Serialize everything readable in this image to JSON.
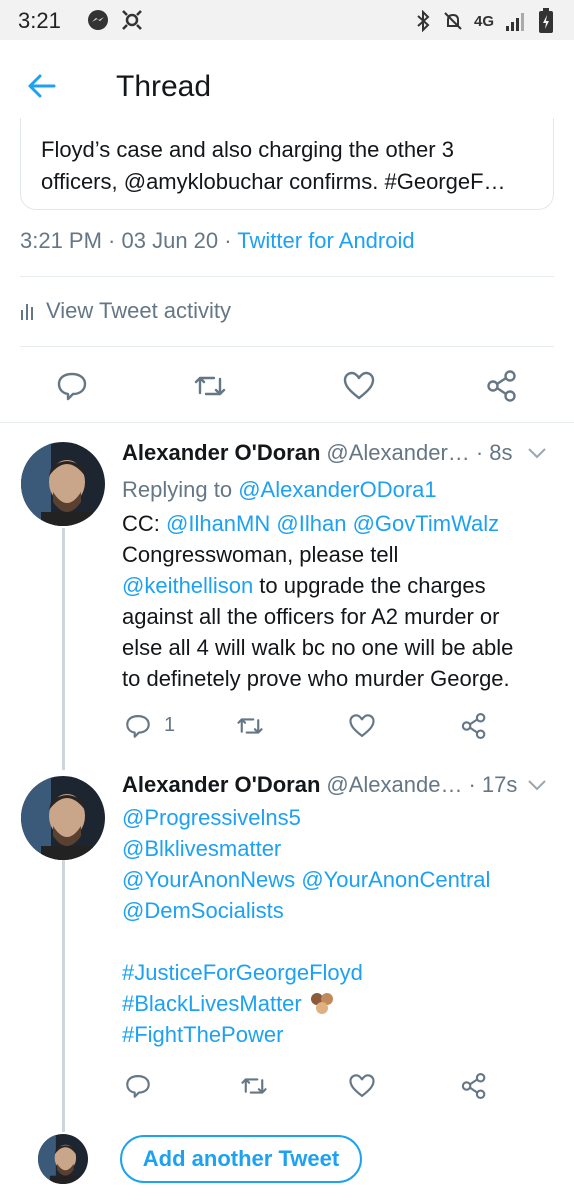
{
  "status_bar": {
    "time": "3:21",
    "network": "4G"
  },
  "header": {
    "title": "Thread"
  },
  "quoted_tweet": {
    "line1": "Floyd’s case and also charging the other 3",
    "line2": "officers, @amyklobuchar confirms. #GeorgeF…"
  },
  "tweet_meta": {
    "time": "3:21 PM",
    "sep1": " · ",
    "date": "03 Jun 20",
    "sep2": " · ",
    "source": "Twitter for Android"
  },
  "activity": {
    "label": "View Tweet activity"
  },
  "replies": [
    {
      "name": "Alexander O'Doran",
      "handle": "@Alexander…",
      "time": "· 8s",
      "replying_prefix": "Replying to ",
      "replying_to": "@AlexanderODora1",
      "cc_prefix": "CC: ",
      "mentions": [
        "@IlhanMN",
        "@Ilhan",
        "@GovTimWalz"
      ],
      "line3": "Congresswoman, please tell",
      "mention4": "@keithellison",
      "line4_rest": " to upgrade the charges",
      "line5": "against all the officers for A2 murder or",
      "line6": "else all 4 will walk bc no one will be able",
      "line7": "to definetely prove who murder George.",
      "reply_count": "1"
    },
    {
      "name": "Alexander O'Doran",
      "handle": "@Alexande…",
      "time": "· 17s",
      "line1": "@Progressivelns5",
      "line2": "@Blklivesmatter",
      "line3a": "@YourAnonNews",
      "line3b": "@YourAnonCentral",
      "line4": "@DemSocialists",
      "line5": "#JusticeForGeorgeFloyd",
      "line6": "#BlackLivesMatter",
      "line7": "#FightThePower"
    }
  ],
  "compose": {
    "add_label": "Add another Tweet"
  },
  "colors": {
    "accent": "#1da1f2",
    "muted": "#657786",
    "text": "#14171a",
    "line": "#ccd6dd"
  }
}
